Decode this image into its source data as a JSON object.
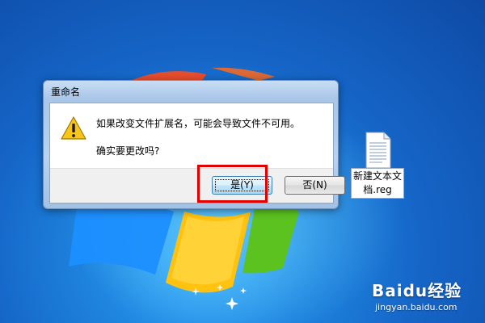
{
  "dialog": {
    "title": "重命名",
    "message": "如果改变文件扩展名，可能会导致文件不可用。",
    "question": "确实要更改吗?",
    "yes_button": "是(Y)",
    "no_button": "否(N)"
  },
  "desktop": {
    "file": {
      "name_line1": "新建文本文",
      "name_line2": "档.reg",
      "icon": "text-document-icon"
    }
  },
  "watermark": {
    "brand": "Baidu经验",
    "url": "jingyan.baidu.com"
  },
  "colors": {
    "highlight": "#e00000",
    "desktop_blue": "#1f86e0",
    "dialog_frame": "#a9c6e8"
  }
}
